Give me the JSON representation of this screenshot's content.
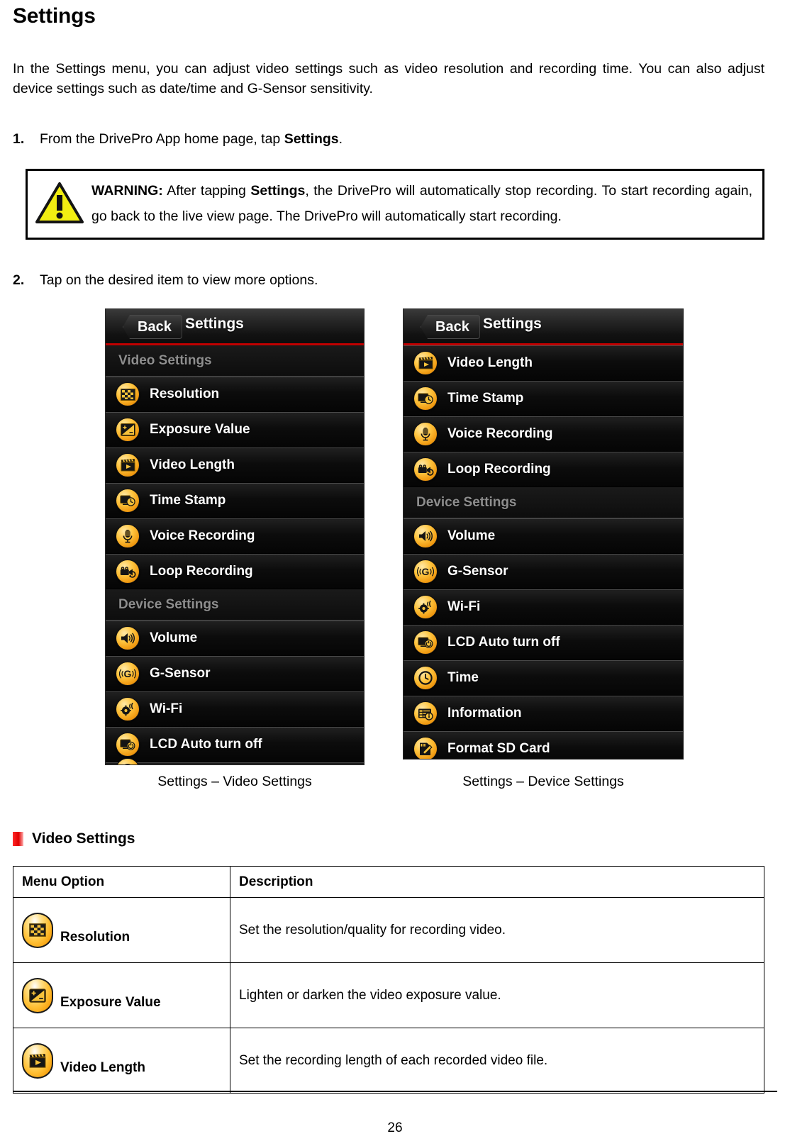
{
  "document": {
    "title": "Settings",
    "intro": "In the Settings menu, you can adjust video settings such as video resolution and recording time. You can also adjust device settings such as date/time and G-Sensor sensitivity.",
    "page_number": "26"
  },
  "steps": [
    {
      "num": "1.",
      "text_before": "From the DrivePro App home page, tap ",
      "bold": "Settings",
      "text_after": "."
    },
    {
      "num": "2.",
      "text_before": "Tap on the desired item to view more options.",
      "bold": "",
      "text_after": ""
    }
  ],
  "warning": {
    "icon": "warning-triangle-icon",
    "label": "WARNING:",
    "text_1": " After tapping ",
    "bold": "Settings",
    "text_2": ", the DrivePro will automatically stop recording. To start recording again, go back to the live view page. The DrivePro will automatically start recording."
  },
  "screenshot_left": {
    "caption": "Settings – Video Settings",
    "topbar": {
      "back_label": "Back",
      "title": "Settings"
    },
    "groups": [
      {
        "header": "Video Settings",
        "items": [
          {
            "label": "Resolution",
            "icon": "checkerboard-icon"
          },
          {
            "label": "Exposure Value",
            "icon": "exposure-plus-minus-icon"
          },
          {
            "label": "Video Length",
            "icon": "clapperboard-play-icon"
          },
          {
            "label": "Time Stamp",
            "icon": "monitor-clock-icon"
          },
          {
            "label": "Voice Recording",
            "icon": "microphone-icon"
          },
          {
            "label": "Loop Recording",
            "icon": "camcorder-loop-icon"
          }
        ]
      },
      {
        "header": "Device Settings",
        "items": [
          {
            "label": "Volume",
            "icon": "speaker-icon"
          },
          {
            "label": "G-Sensor",
            "icon": "g-sensor-icon"
          },
          {
            "label": "Wi-Fi",
            "icon": "gear-wifi-icon"
          },
          {
            "label": "LCD Auto turn off",
            "icon": "monitor-power-icon"
          }
        ]
      }
    ]
  },
  "screenshot_right": {
    "caption": "Settings – Device Settings",
    "topbar": {
      "back_label": "Back",
      "title": "Settings"
    },
    "groups": [
      {
        "header": "",
        "items": [
          {
            "label": "Video Length",
            "icon": "clapperboard-play-icon"
          },
          {
            "label": "Time Stamp",
            "icon": "monitor-clock-icon"
          },
          {
            "label": "Voice Recording",
            "icon": "microphone-icon"
          },
          {
            "label": "Loop Recording",
            "icon": "camcorder-loop-icon"
          }
        ]
      },
      {
        "header": "Device Settings",
        "items": [
          {
            "label": "Volume",
            "icon": "speaker-icon"
          },
          {
            "label": "G-Sensor",
            "icon": "g-sensor-icon"
          },
          {
            "label": "Wi-Fi",
            "icon": "gear-wifi-icon"
          },
          {
            "label": "LCD Auto turn off",
            "icon": "monitor-power-icon"
          },
          {
            "label": "Time",
            "icon": "clock-icon"
          },
          {
            "label": "Information",
            "icon": "info-list-icon"
          },
          {
            "label": "Format SD Card",
            "icon": "format-sd-card-icon"
          }
        ]
      }
    ]
  },
  "section": {
    "marker_color": "#e00000",
    "title": "Video Settings"
  },
  "table": {
    "headers": [
      "Menu Option",
      "Description"
    ],
    "rows": [
      {
        "icon": "checkerboard-icon",
        "option": "Resolution",
        "description": "Set the resolution/quality for recording video."
      },
      {
        "icon": "exposure-plus-minus-icon",
        "option": "Exposure Value",
        "description": "Lighten or darken the video exposure value."
      },
      {
        "icon": "clapperboard-play-icon",
        "option": "Video Length",
        "description": "Set the recording length of each recorded video file."
      }
    ]
  }
}
